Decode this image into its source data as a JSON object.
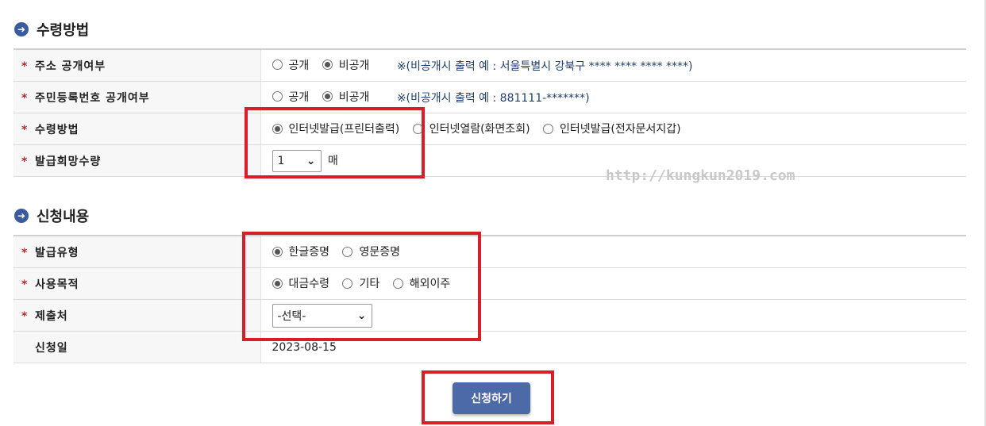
{
  "section1": {
    "title": "수령방법",
    "rows": {
      "address": {
        "label": "주소 공개여부",
        "options": [
          "공개",
          "비공개"
        ],
        "selected": "비공개",
        "note": "※(비공개시 출력 예 : 서울특별시 강북구 **** **** **** ****)"
      },
      "rrn": {
        "label": "주민등록번호 공개여부",
        "options": [
          "공개",
          "비공개"
        ],
        "selected": "비공개",
        "note": "※(비공개시 출력 예 : 881111-*******)"
      },
      "method": {
        "label": "수령방법",
        "options": [
          "인터넷발급(프린터출력)",
          "인터넷열람(화면조회)",
          "인터넷발급(전자문서지갑)"
        ],
        "selected": "인터넷발급(프린터출력)"
      },
      "quantity": {
        "label": "발급희망수량",
        "value": "1",
        "unit": "매"
      }
    }
  },
  "watermark": "http://kungkun2019.com",
  "section2": {
    "title": "신청내용",
    "rows": {
      "type": {
        "label": "발급유형",
        "options": [
          "한글증명",
          "영문증명"
        ],
        "selected": "한글증명"
      },
      "purpose": {
        "label": "사용목적",
        "options": [
          "대금수령",
          "기타",
          "해외이주"
        ],
        "selected": "대금수령"
      },
      "submitTo": {
        "label": "제출처",
        "value": "-선택-"
      },
      "date": {
        "label": "신청일",
        "value": "2023-08-15"
      }
    }
  },
  "submit_label": "신청하기",
  "colors": {
    "accent": "#4d6aa8",
    "highlight": "#d81e28",
    "required": "#c0282f"
  }
}
